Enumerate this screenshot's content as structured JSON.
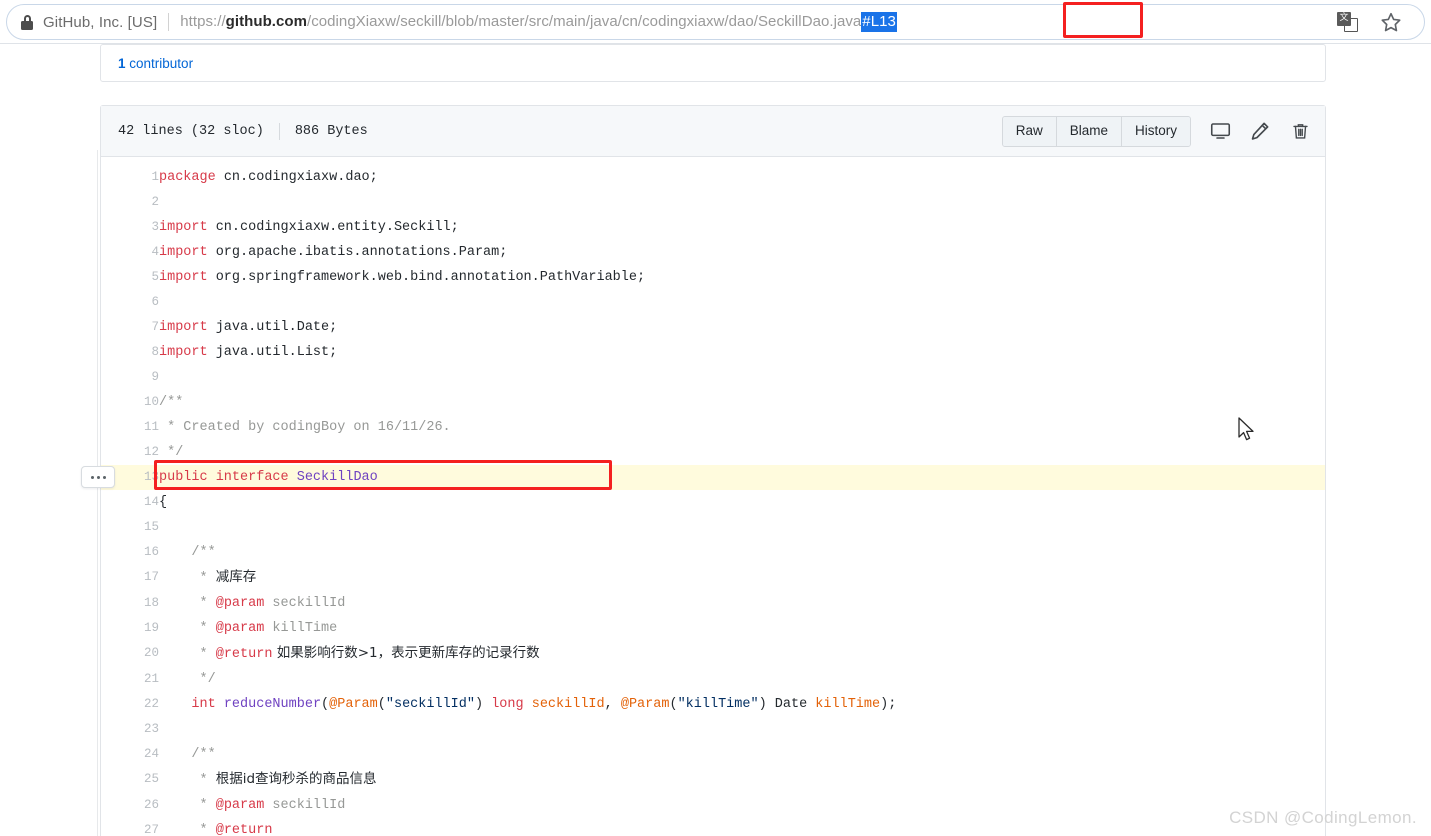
{
  "browser": {
    "security_label": "GitHub, Inc. [US]",
    "lock_icon": "lock-icon",
    "url": {
      "scheme": "https://",
      "host_strong": "github.com",
      "path": "/codingXiaxw/seckill/blob/master/src/main/java/cn/codingxiaxw/dao/SeckillDao.java",
      "fragment": "#L13",
      "fragment_selected": true
    },
    "translate_icon": "translate-icon",
    "translate_glyph": "文",
    "bookmark_icon": "star-icon"
  },
  "page": {
    "contributors_count": "1",
    "contributors_label": "contributor",
    "file": {
      "lines_info": "42 lines (32 sloc)",
      "size_info": "886 Bytes",
      "buttons": [
        {
          "label": "Raw",
          "name": "raw-button"
        },
        {
          "label": "Blame",
          "name": "blame-button"
        },
        {
          "label": "History",
          "name": "history-button"
        }
      ],
      "icons": [
        {
          "name": "open-desktop-icon"
        },
        {
          "name": "edit-pencil-icon"
        },
        {
          "name": "delete-trash-icon"
        }
      ],
      "highlighted_line": 13,
      "kebab_menu_label": "···",
      "code_lines": [
        {
          "n": 1,
          "tokens": [
            {
              "t": "k",
              "v": "package"
            },
            {
              "t": "cn",
              "v": " cn.codingxiaxw.dao;"
            }
          ]
        },
        {
          "n": 2,
          "tokens": []
        },
        {
          "n": 3,
          "tokens": [
            {
              "t": "k",
              "v": "import"
            },
            {
              "t": "cn",
              "v": " cn.codingxiaxw.entity.Seckill;"
            }
          ]
        },
        {
          "n": 4,
          "tokens": [
            {
              "t": "k",
              "v": "import"
            },
            {
              "t": "cn",
              "v": " org.apache.ibatis.annotations.Param;"
            }
          ]
        },
        {
          "n": 5,
          "tokens": [
            {
              "t": "k",
              "v": "import"
            },
            {
              "t": "cn",
              "v": " org.springframework.web.bind.annotation.PathVariable;"
            }
          ]
        },
        {
          "n": 6,
          "tokens": []
        },
        {
          "n": 7,
          "tokens": [
            {
              "t": "k",
              "v": "import"
            },
            {
              "t": "cn",
              "v": " java.util.Date;"
            }
          ]
        },
        {
          "n": 8,
          "tokens": [
            {
              "t": "k",
              "v": "import"
            },
            {
              "t": "cn",
              "v": " java.util.List;"
            }
          ]
        },
        {
          "n": 9,
          "tokens": []
        },
        {
          "n": 10,
          "tokens": [
            {
              "t": "c",
              "v": "/**"
            }
          ]
        },
        {
          "n": 11,
          "tokens": [
            {
              "t": "c",
              "v": " * Created by codingBoy on 16/11/26."
            }
          ]
        },
        {
          "n": 12,
          "tokens": [
            {
              "t": "c",
              "v": " */"
            }
          ]
        },
        {
          "n": 13,
          "tokens": [
            {
              "t": "k",
              "v": "public interface "
            },
            {
              "t": "t",
              "v": "SeckillDao"
            }
          ]
        },
        {
          "n": 14,
          "tokens": [
            {
              "t": "cn",
              "v": "{"
            }
          ]
        },
        {
          "n": 15,
          "tokens": []
        },
        {
          "n": 16,
          "tokens": [
            {
              "t": "c",
              "v": "    /**"
            }
          ]
        },
        {
          "n": 17,
          "tokens": [
            {
              "t": "c",
              "v": "     * "
            },
            {
              "t": "cm-zh",
              "v": "减库存"
            }
          ]
        },
        {
          "n": 18,
          "tokens": [
            {
              "t": "c",
              "v": "     * "
            },
            {
              "t": "an",
              "v": "@param"
            },
            {
              "t": "c",
              "v": " seckillId"
            }
          ]
        },
        {
          "n": 19,
          "tokens": [
            {
              "t": "c",
              "v": "     * "
            },
            {
              "t": "an",
              "v": "@param"
            },
            {
              "t": "c",
              "v": " killTime"
            }
          ]
        },
        {
          "n": 20,
          "tokens": [
            {
              "t": "c",
              "v": "     * "
            },
            {
              "t": "an",
              "v": "@return"
            },
            {
              "t": "cm-zh",
              "v": " 如果影响行数>1，表示更新库存的记录行数"
            }
          ]
        },
        {
          "n": 21,
          "tokens": [
            {
              "t": "c",
              "v": "     */"
            }
          ]
        },
        {
          "n": 22,
          "tokens": [
            {
              "t": "cn",
              "v": "    "
            },
            {
              "t": "k",
              "v": "int"
            },
            {
              "t": "cn",
              "v": " "
            },
            {
              "t": "t",
              "v": "reduceNumber"
            },
            {
              "t": "cn",
              "v": "("
            },
            {
              "t": "a",
              "v": "@Param"
            },
            {
              "t": "cn",
              "v": "("
            },
            {
              "t": "s",
              "v": "\"seckillId\""
            },
            {
              "t": "cn",
              "v": ") "
            },
            {
              "t": "k",
              "v": "long"
            },
            {
              "t": "cn",
              "v": " "
            },
            {
              "t": "a",
              "v": "seckillId"
            },
            {
              "t": "cn",
              "v": ", "
            },
            {
              "t": "a",
              "v": "@Param"
            },
            {
              "t": "cn",
              "v": "("
            },
            {
              "t": "s",
              "v": "\"killTime\""
            },
            {
              "t": "cn",
              "v": ") Date "
            },
            {
              "t": "a",
              "v": "killTime"
            },
            {
              "t": "cn",
              "v": ");"
            }
          ]
        },
        {
          "n": 23,
          "tokens": []
        },
        {
          "n": 24,
          "tokens": [
            {
              "t": "c",
              "v": "    /**"
            }
          ]
        },
        {
          "n": 25,
          "tokens": [
            {
              "t": "c",
              "v": "     * "
            },
            {
              "t": "cm-zh",
              "v": "根据id查询秒杀的商品信息"
            }
          ]
        },
        {
          "n": 26,
          "tokens": [
            {
              "t": "c",
              "v": "     * "
            },
            {
              "t": "an",
              "v": "@param"
            },
            {
              "t": "c",
              "v": " seckillId"
            }
          ]
        },
        {
          "n": 27,
          "tokens": [
            {
              "t": "c",
              "v": "     * "
            },
            {
              "t": "an",
              "v": "@return"
            }
          ]
        }
      ]
    }
  },
  "overlay": {
    "watermark": "CSDN @CodingLemon.",
    "annotation_color": "#f42020",
    "selection_color": "#1a73e8",
    "highlight_color": "#fffbdd",
    "cursor": "arrow-cursor"
  }
}
